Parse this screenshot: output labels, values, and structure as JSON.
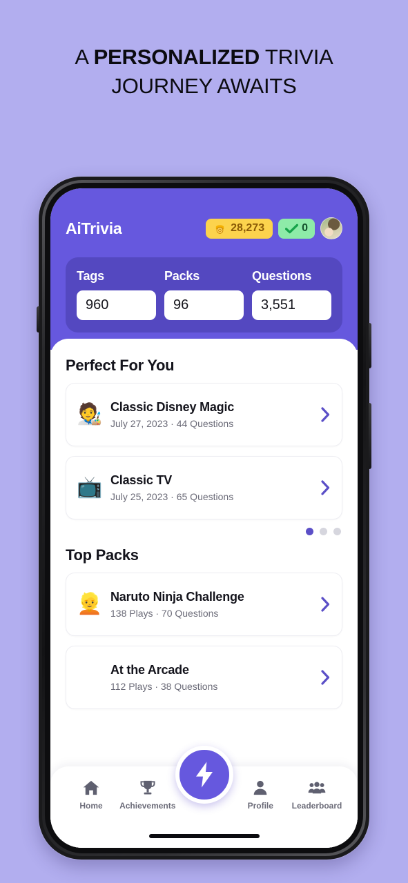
{
  "headline": {
    "line1_pre": "A ",
    "line1_strong": "PERSONALIZED",
    "line1_post": " TRIVIA",
    "line2": "JOURNEY AWAITS"
  },
  "colors": {
    "page_background": "#b2aeef",
    "header_purple": "#6658de",
    "stats_panel_purple": "#5448c0",
    "accent_chevron": "#5b4fc7",
    "coin_badge": "#fcd34d",
    "streak_badge": "#8eeba8"
  },
  "app": {
    "brand": "AiTrivia",
    "coins": {
      "icon": "coin-stack-icon",
      "value": "28,273"
    },
    "streak": {
      "icon": "check-mark-icon",
      "value": "0"
    },
    "avatar": {
      "icon": "avatar-photo"
    },
    "stats": [
      {
        "label": "Tags",
        "value": "960"
      },
      {
        "label": "Packs",
        "value": "96"
      },
      {
        "label": "Questions",
        "value": "3,551"
      }
    ]
  },
  "sections": {
    "perfect_for_you": {
      "title": "Perfect For You",
      "cards": [
        {
          "emoji": "🧑‍🎨",
          "icon_name": "disney-character-emoji",
          "title": "Classic Disney Magic",
          "subtitle": "July 27, 2023 · 44 Questions"
        },
        {
          "emoji": "📺",
          "icon_name": "television-emoji",
          "title": "Classic TV",
          "subtitle": "July 25, 2023 · 65 Questions"
        }
      ],
      "pagination": {
        "total": 3,
        "active": 1
      }
    },
    "top_packs": {
      "title": "Top Packs",
      "cards": [
        {
          "emoji": "👱",
          "icon_name": "ninja-character-emoji",
          "title": "Naruto Ninja Challenge",
          "subtitle": "138 Plays · 70 Questions"
        },
        {
          "emoji": "",
          "icon_name": "no-icon",
          "title": "At the Arcade",
          "subtitle": "112 Plays · 38 Questions"
        }
      ]
    }
  },
  "bottom_nav": {
    "items": [
      {
        "label": "Home",
        "icon": "home-icon"
      },
      {
        "label": "Achievements",
        "icon": "trophy-icon"
      },
      {
        "label": "Profile",
        "icon": "person-icon"
      },
      {
        "label": "Leaderboard",
        "icon": "people-group-icon"
      }
    ],
    "fab": {
      "icon": "lightning-bolt-icon"
    }
  }
}
